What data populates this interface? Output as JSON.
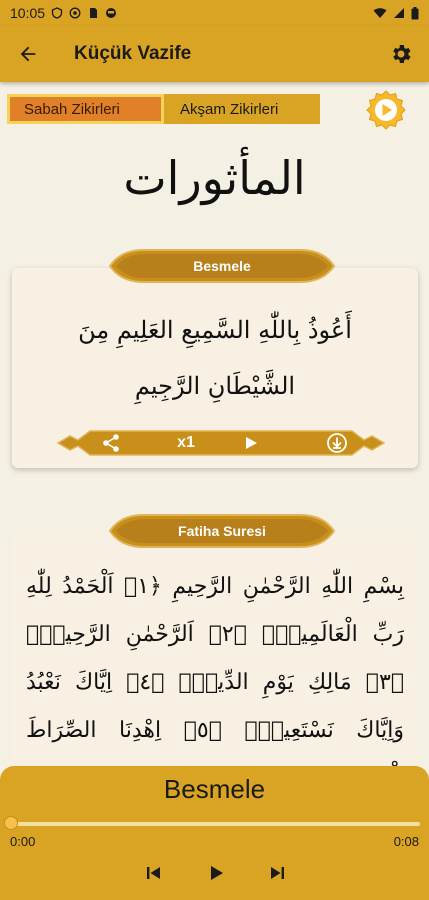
{
  "status_bar": {
    "time": "10:05",
    "icons": [
      "shield-icon",
      "at-icon",
      "sim-icon",
      "circle-icon",
      "wifi-icon",
      "signal-icon",
      "battery-icon"
    ]
  },
  "app_bar": {
    "title": "Küçük Vazife",
    "back_icon": "back-arrow-icon",
    "settings_icon": "gear-icon"
  },
  "tabs": [
    {
      "label": "Sabah Zikirleri",
      "active": true
    },
    {
      "label": "Akşam Zikirleri",
      "active": false
    }
  ],
  "header_calligraphy": "المأثورات",
  "cards": [
    {
      "title": "Besmele",
      "text": "أَعُوذُ بِاللّٰهِ السَّمِيعِ العَلِيمِ مِنَ الشَّيْطَانِ الرَّجِيمِ",
      "repeat": "x1"
    },
    {
      "title": "Fatiha Suresi",
      "text": "بِسْمِ اللّٰهِ الرَّحْمٰنِ الرَّحِيمِ ﴿١﴾ اَلْحَمْدُ لِلّٰهِ رَبِّ الْعَالَمِينَۙ ﴿٢﴾ اَلرَّحْمٰنِ الرَّحِيمِۙ ﴿٣﴾ مَالِكِ يَوْمِ الدِّينِۜ ﴿٤﴾ اِيَّاكَ نَعْبُدُ وَاِيَّاكَ نَسْتَعِينُۜ ﴿٥﴾ اِهْدِنَا الصِّرَاطَ الْمُسْتَقِيمَۙ"
    }
  ],
  "player": {
    "title": "Besmele",
    "time_current": "0:00",
    "time_total": "0:08",
    "progress": 0.0
  },
  "colors": {
    "accent": "#d9a423",
    "tab_active": "#e0812a",
    "background": "#f5f0e4",
    "card_header": "#c8901a"
  }
}
